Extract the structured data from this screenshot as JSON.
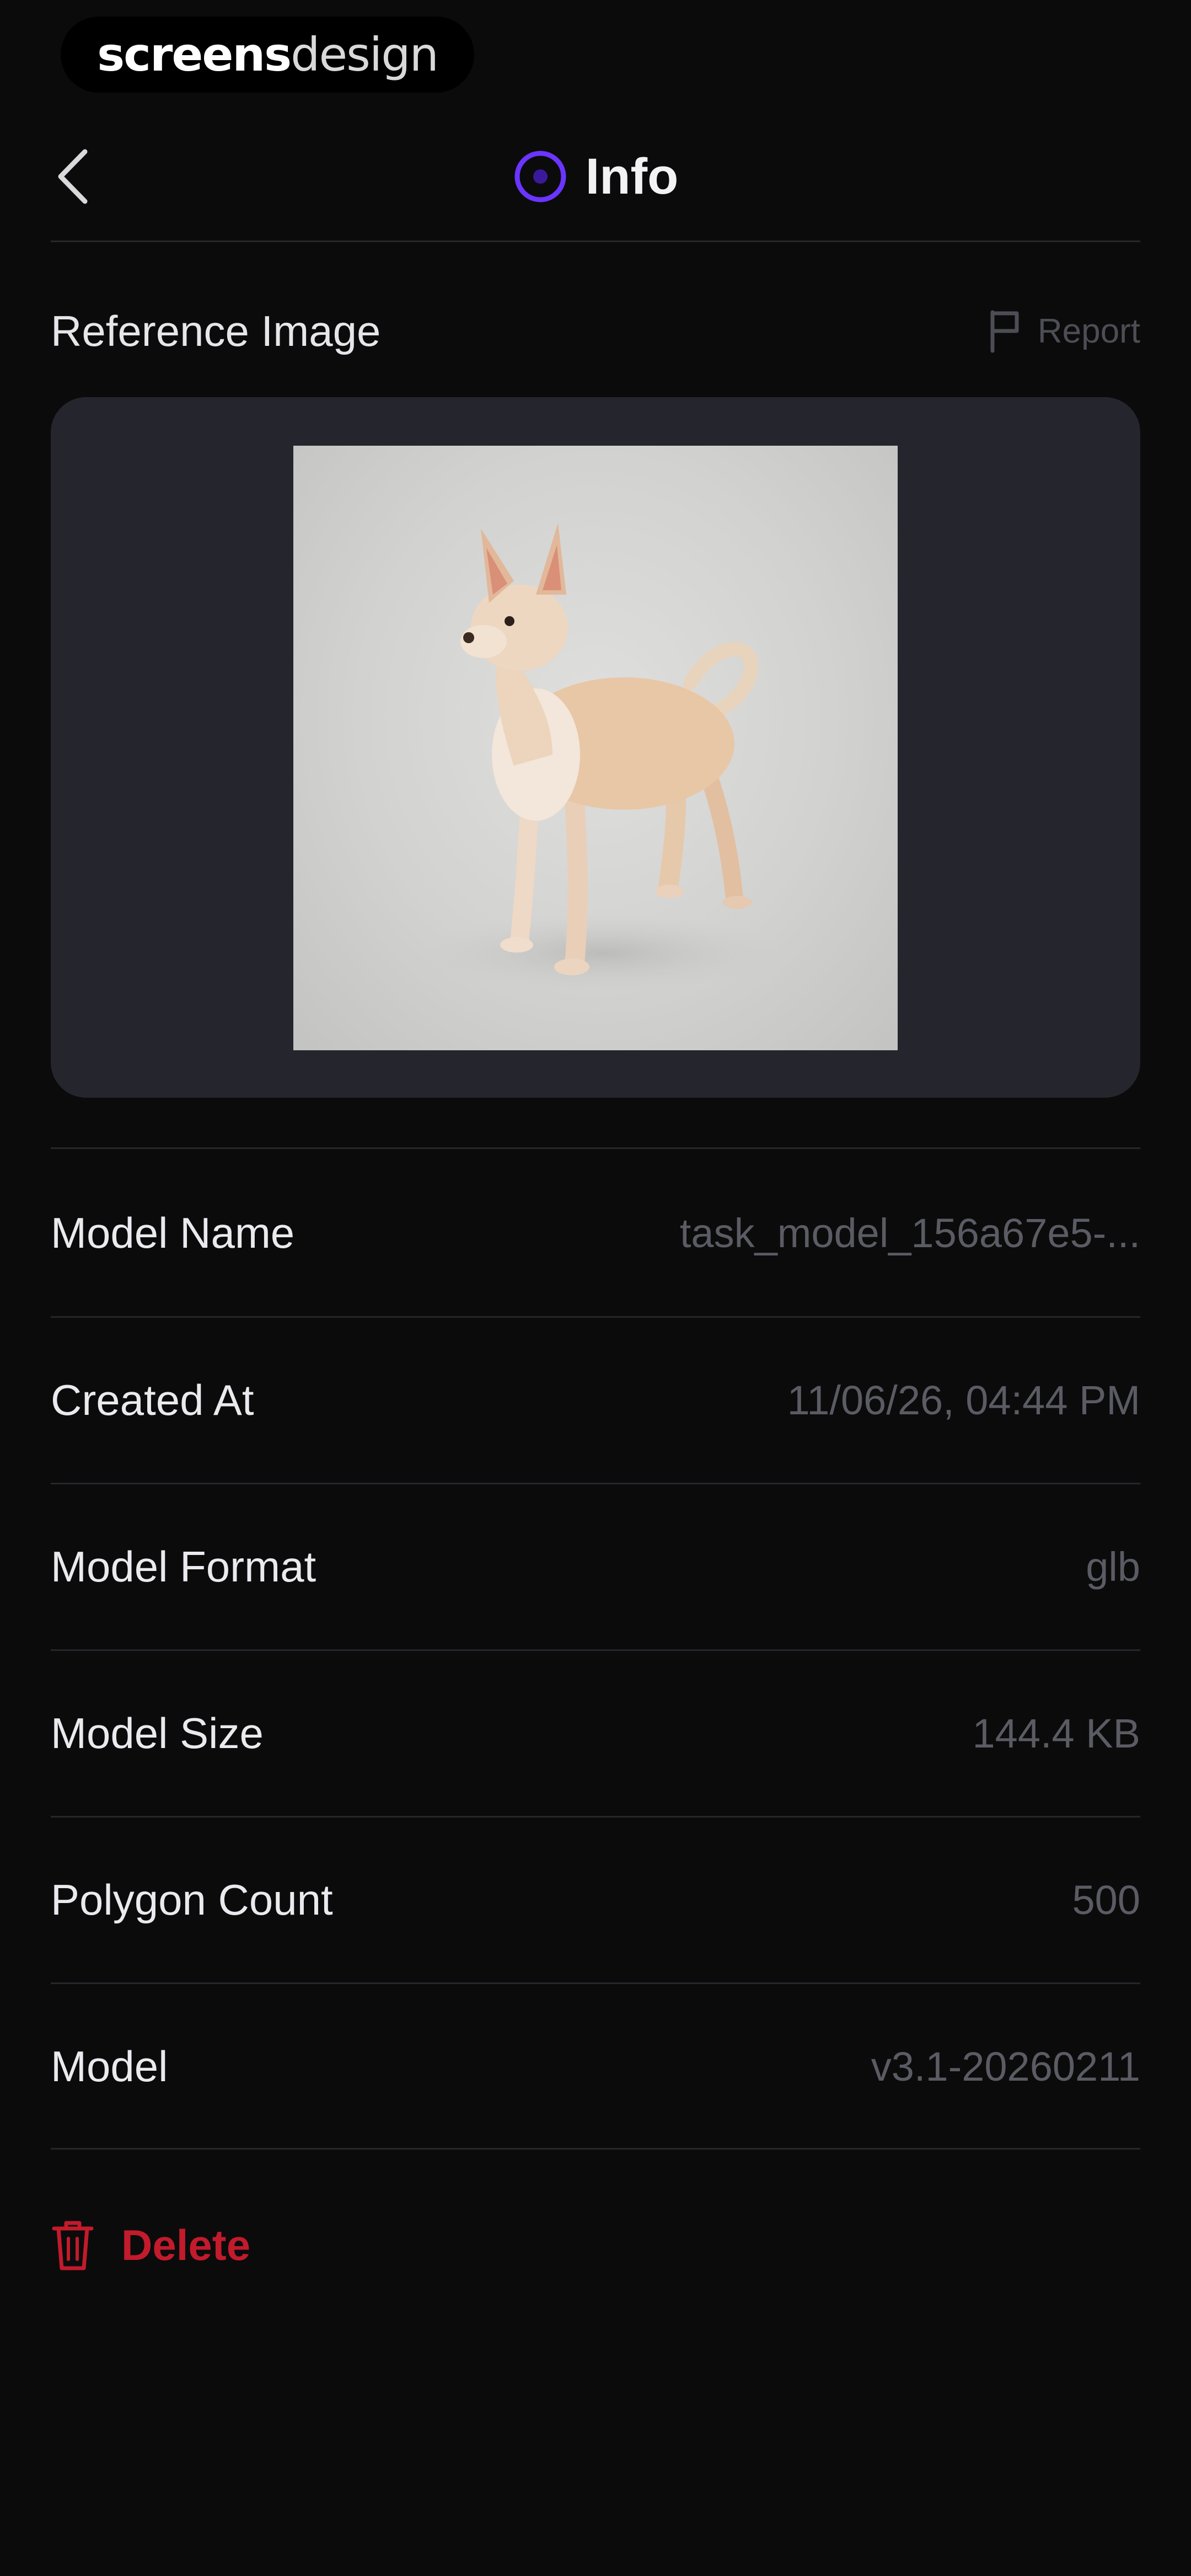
{
  "watermark": {
    "part1": "screens",
    "part2": "design"
  },
  "header": {
    "title": "Info",
    "back_icon": "chevron-left-icon",
    "title_icon": "info-icon"
  },
  "colors": {
    "accent": "#6a35ff",
    "danger": "#c21b2c",
    "background": "#0b0b0c",
    "card": "#25252e"
  },
  "reference": {
    "label": "Reference Image",
    "report_label": "Report",
    "report_icon": "flag-icon",
    "image_subject": "dog-photo"
  },
  "details": [
    {
      "label": "Model Name",
      "value": "task_model_156a67e5-..."
    },
    {
      "label": "Created At",
      "value": "11/06/26, 04:44 PM"
    },
    {
      "label": "Model Format",
      "value": "glb"
    },
    {
      "label": "Model Size",
      "value": "144.4 KB"
    },
    {
      "label": "Polygon Count",
      "value": "500"
    },
    {
      "label": "Model",
      "value": "v3.1-20260211"
    }
  ],
  "delete": {
    "label": "Delete",
    "icon": "trash-icon"
  }
}
